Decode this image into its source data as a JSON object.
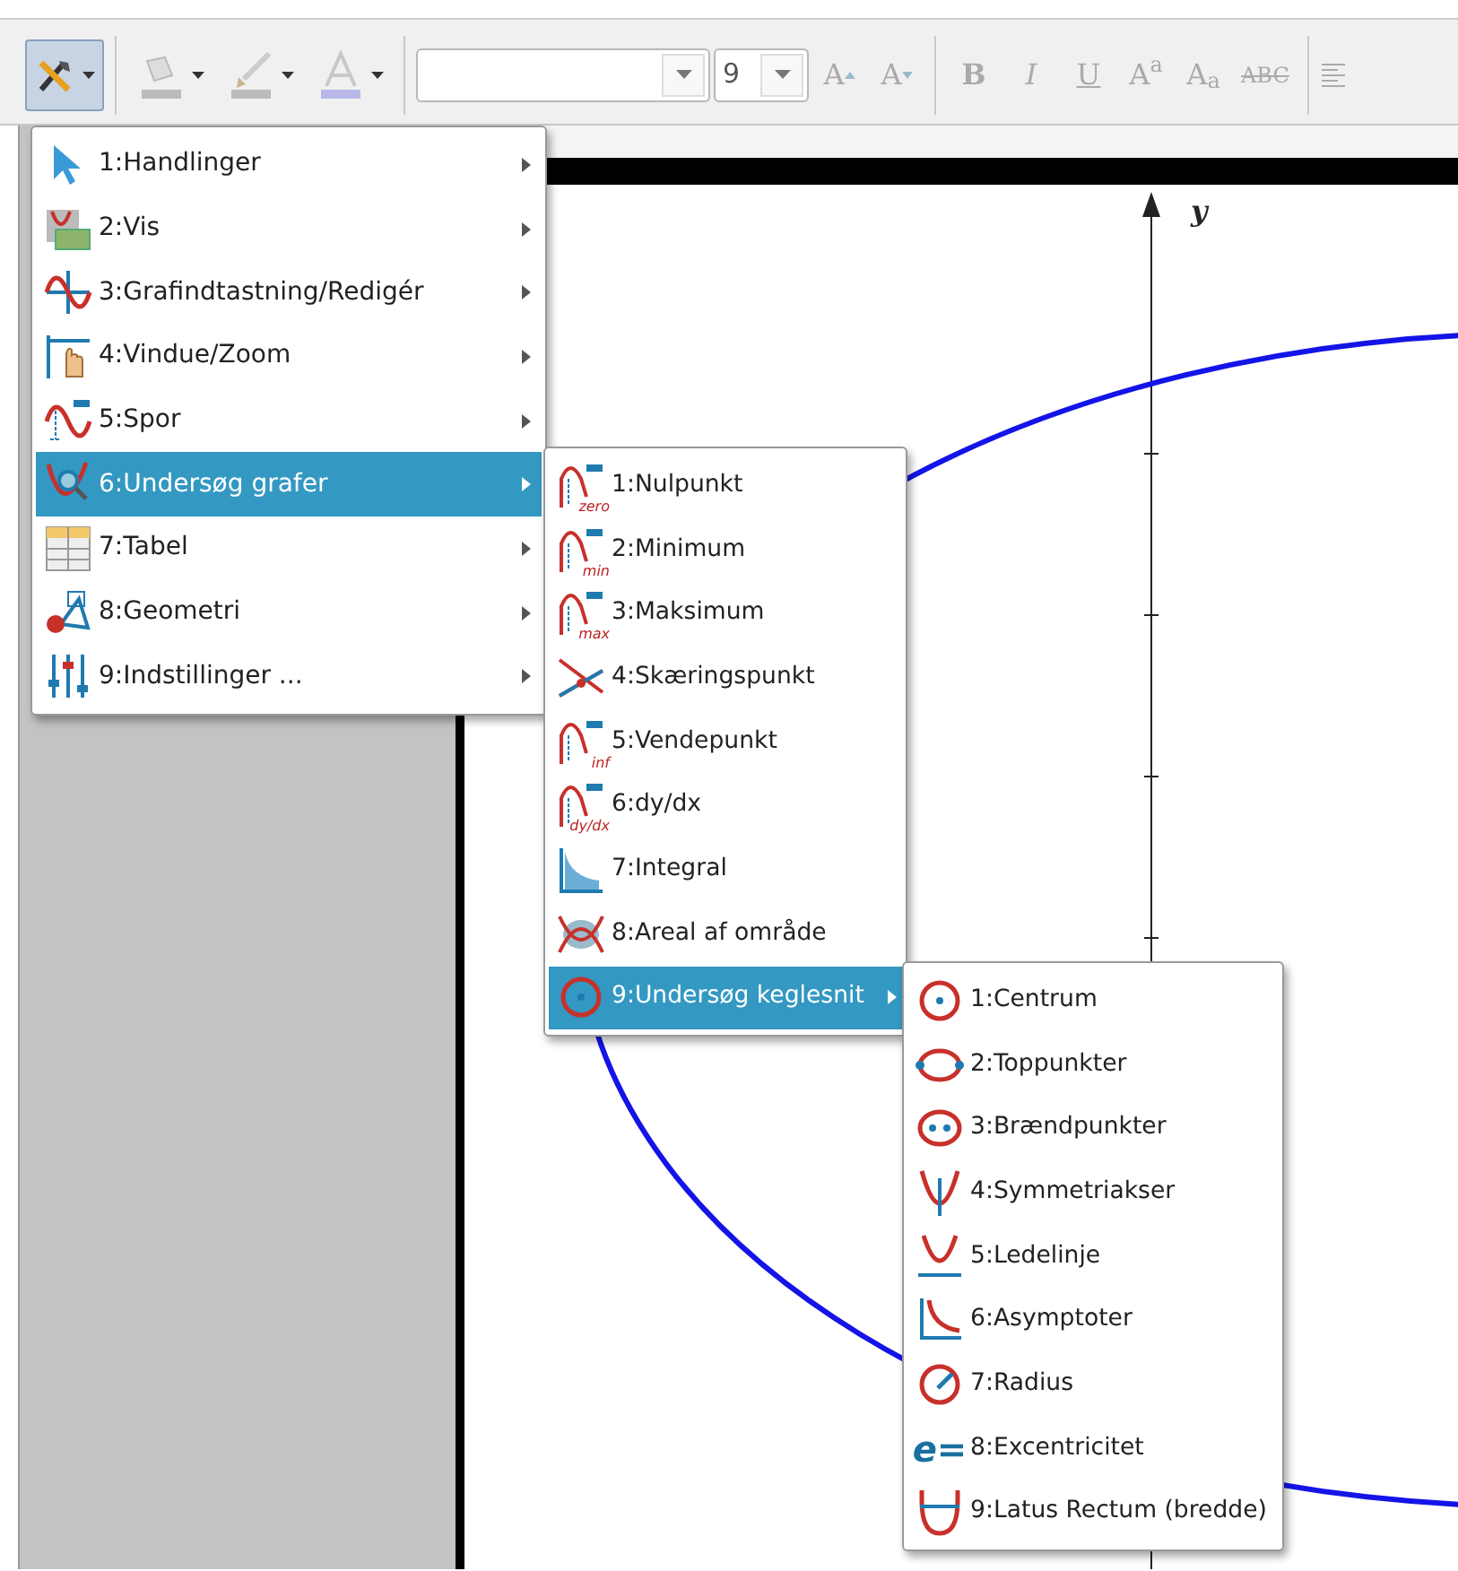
{
  "toolbar": {
    "tools_button": {
      "pressed": true
    },
    "size_field": {
      "value": "9"
    },
    "format_buttons": [
      {
        "label": "A",
        "kind": "grow",
        "disabled": true
      },
      {
        "label": "A",
        "kind": "shrink",
        "disabled": true
      },
      {
        "label": "B",
        "kind": "bold",
        "disabled": true
      },
      {
        "label": "I",
        "kind": "italic",
        "disabled": true
      },
      {
        "label": "U",
        "kind": "underline",
        "disabled": true
      },
      {
        "label": "A$^{a}$",
        "kind": "superscript",
        "disabled": true
      },
      {
        "label": "A$_{a}$",
        "kind": "subscript",
        "disabled": true
      },
      {
        "label": "ABC",
        "kind": "strike",
        "disabled": true
      }
    ]
  },
  "graph": {
    "axis_label": "y"
  },
  "menus": [
    {
      "items": [
        {
          "label": "1:Handlinger",
          "selected": false,
          "submenu": true
        },
        {
          "label": "2:Vis",
          "selected": false,
          "submenu": true
        },
        {
          "label": "3:Grafindtastning/Redigér",
          "selected": false,
          "submenu": true
        },
        {
          "label": "4:Vindue/Zoom",
          "selected": false,
          "submenu": true
        },
        {
          "label": "5:Spor",
          "selected": false,
          "submenu": true
        },
        {
          "label": "6:Undersøg grafer",
          "selected": true,
          "submenu": true
        },
        {
          "label": "7:Tabel",
          "selected": false,
          "submenu": true
        },
        {
          "label": "8:Geometri",
          "selected": false,
          "submenu": true
        },
        {
          "label": "9:Indstillinger ...",
          "selected": false,
          "submenu": true
        }
      ]
    },
    {
      "items": [
        {
          "label": "1:Nulpunkt",
          "selected": false,
          "submenu": false,
          "icon_label": "zero"
        },
        {
          "label": "2:Minimum",
          "selected": false,
          "submenu": false,
          "icon_label": "min"
        },
        {
          "label": "3:Maksimum",
          "selected": false,
          "submenu": false,
          "icon_label": "max"
        },
        {
          "label": "4:Skæringspunkt",
          "selected": false,
          "submenu": false
        },
        {
          "label": "5:Vendepunkt",
          "selected": false,
          "submenu": false,
          "icon_label": "inf"
        },
        {
          "label": "6:dy/dx",
          "selected": false,
          "submenu": false,
          "icon_label": "dy/dx"
        },
        {
          "label": "7:Integral",
          "selected": false,
          "submenu": false
        },
        {
          "label": "8:Areal af område",
          "selected": false,
          "submenu": false
        },
        {
          "label": "9:Undersøg keglesnit",
          "selected": true,
          "submenu": true
        }
      ]
    },
    {
      "items": [
        {
          "label": "1:Centrum",
          "selected": false,
          "submenu": false
        },
        {
          "label": "2:Toppunkter",
          "selected": false,
          "submenu": false
        },
        {
          "label": "3:Brændpunkter",
          "selected": false,
          "submenu": false
        },
        {
          "label": "4:Symmetriakser",
          "selected": false,
          "submenu": false
        },
        {
          "label": "5:Ledelinje",
          "selected": false,
          "submenu": false
        },
        {
          "label": "6:Asymptoter",
          "selected": false,
          "submenu": false
        },
        {
          "label": "7:Radius",
          "selected": false,
          "submenu": false
        },
        {
          "label": "8:Excentricitet",
          "selected": false,
          "submenu": false,
          "icon_label": "e="
        },
        {
          "label": "9:Latus Rectum (bredde)",
          "selected": false,
          "submenu": false
        }
      ]
    }
  ]
}
